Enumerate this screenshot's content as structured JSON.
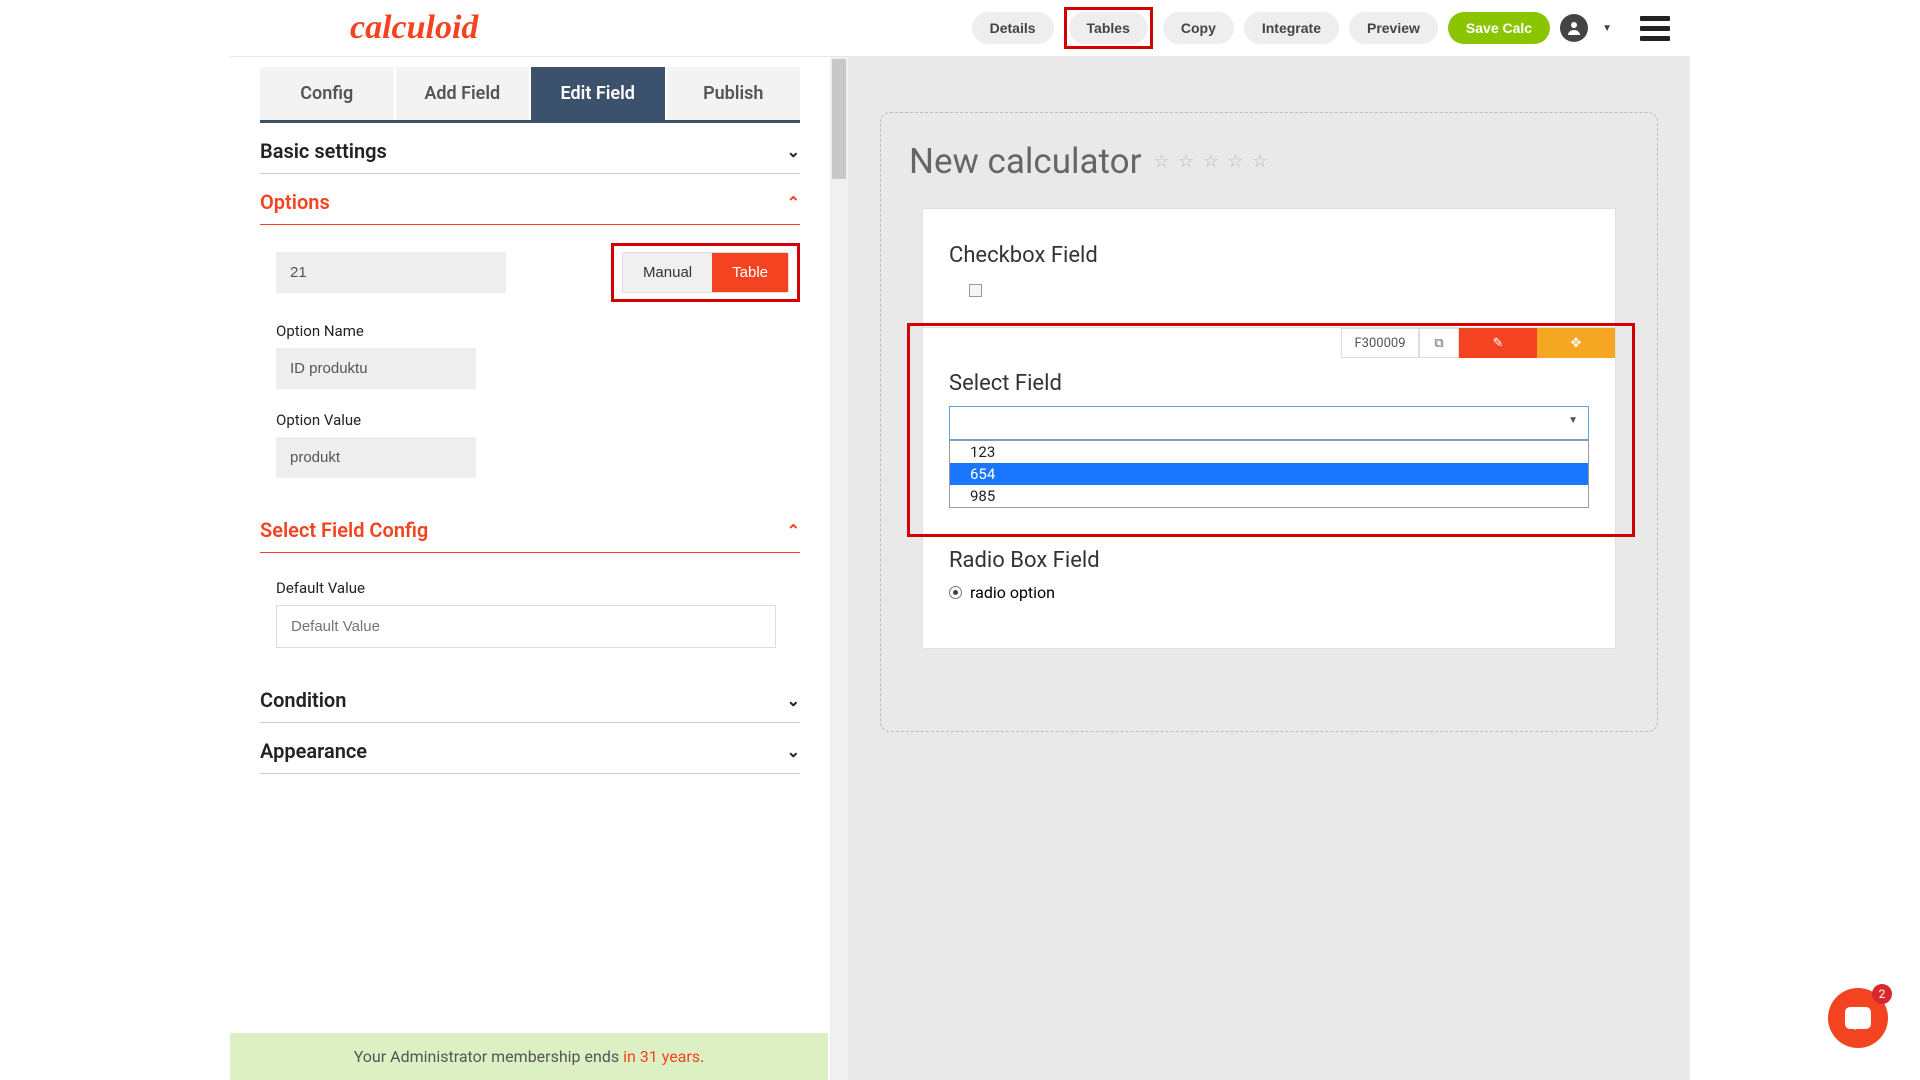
{
  "header": {
    "logo": "calculoid",
    "nav": {
      "details": "Details",
      "tables": "Tables",
      "copy": "Copy",
      "integrate": "Integrate",
      "preview": "Preview",
      "save": "Save Calc"
    }
  },
  "sidebar": {
    "tabs": {
      "config": "Config",
      "add": "Add Field",
      "edit": "Edit Field",
      "publish": "Publish"
    },
    "acc": {
      "basic": "Basic settings",
      "options": "Options",
      "select_cfg": "Select Field Config",
      "condition": "Condition",
      "appearance": "Appearance"
    },
    "options": {
      "number_value": "21",
      "toggle": {
        "manual": "Manual",
        "table": "Table"
      },
      "name_label": "Option Name",
      "name_value": "ID produktu",
      "value_label": "Option Value",
      "value_value": "produkt"
    },
    "selectcfg": {
      "default_label": "Default Value",
      "default_placeholder": "Default Value"
    }
  },
  "preview": {
    "title": "New calculator",
    "checkbox_title": "Checkbox Field",
    "field_id": "F300009",
    "select_title": "Select Field",
    "dropdown": [
      "123",
      "654",
      "985"
    ],
    "radio_title": "Radio Box Field",
    "radio_option": "radio option"
  },
  "footer": {
    "msg1": "Your Administrator membership ends ",
    "msg2": "in 31 years",
    "msg3": "."
  },
  "chat_badge": "2"
}
